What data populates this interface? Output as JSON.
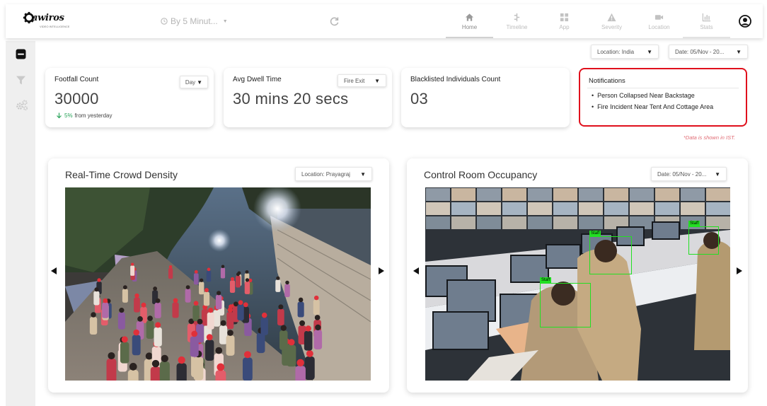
{
  "brand": {
    "name": "awiros",
    "tagline": "VIDEO INTELLIGENCE"
  },
  "header": {
    "interval_label": "By 5 Minut...",
    "nav": [
      {
        "label": "Home",
        "icon": "home-icon"
      },
      {
        "label": "Timeline",
        "icon": "timeline-icon"
      },
      {
        "label": "App",
        "icon": "app-grid-icon"
      },
      {
        "label": "Severity",
        "icon": "warning-icon"
      },
      {
        "label": "Location",
        "icon": "video-camera-icon"
      },
      {
        "label": "Stats",
        "icon": "bar-chart-icon"
      }
    ],
    "active_nav": "Home"
  },
  "filters": {
    "location": "Location: India",
    "date": "Date: 05/Nov - 20..."
  },
  "cards": {
    "footfall": {
      "label": "Footfall Count",
      "value": "30000",
      "period": "Day",
      "trend_pct": "5%",
      "trend_text": "from yesterday",
      "trend_direction": "down"
    },
    "dwell": {
      "label": "Avg Dwell Time",
      "value": "30 mins 20 secs",
      "filter": "Fire Exit"
    },
    "blacklist": {
      "label": "Blacklisted Individuals Count",
      "value": "03"
    }
  },
  "notifications": {
    "title": "Notifications",
    "items": [
      "Person Collapsed Near Backstage",
      "Fire Incident Near Tent And Cottage Area"
    ],
    "border_color": "#e0101c"
  },
  "ist_note": "*Data is shown in IST.",
  "panels": {
    "crowd": {
      "title": "Real-Time Crowd Density",
      "filter": "Location: Prayagraj"
    },
    "control_room": {
      "title": "Control Room Occupancy",
      "filter": "Date: 05/Nov - 20...",
      "detections": [
        "Staff",
        "Staff",
        "Staff"
      ]
    }
  },
  "colors": {
    "accent_alert": "#e0101c",
    "trend_green": "#2aa35a",
    "detection_box": "#22e022",
    "sidebar_bg": "#efefef"
  }
}
